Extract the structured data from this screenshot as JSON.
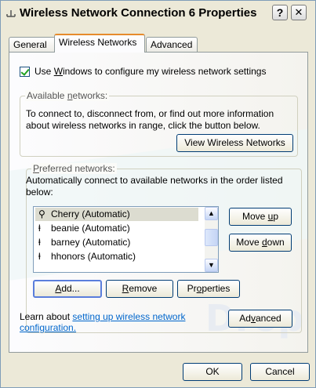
{
  "window": {
    "title": "Wireless Network Connection 6 Properties",
    "help_label": "?",
    "close_label": "✕"
  },
  "tabs": [
    {
      "label": "General"
    },
    {
      "label": "Wireless Networks"
    },
    {
      "label": "Advanced"
    }
  ],
  "use_windows_checkbox": {
    "label_pre": "Use ",
    "label_key": "W",
    "label_post": "indows to configure my wireless network settings",
    "checked": true
  },
  "available": {
    "title_pre": "Available ",
    "title_key": "n",
    "title_post": "etworks:",
    "line1": "To connect to, disconnect from, or find out more information",
    "line2": "about wireless networks in range, click the button below.",
    "view_button": "View Wireless Networks"
  },
  "preferred": {
    "title_key": "P",
    "title_post": "referred networks:",
    "line1": "Automatically connect to available networks in the order listed",
    "line2": "below:",
    "networks": [
      {
        "name": "Cherry (Automatic)",
        "icon": "wireless-network-connected-icon"
      },
      {
        "name": "beanie (Automatic)",
        "icon": "wireless-network-icon"
      },
      {
        "name": "barney (Automatic)",
        "icon": "wireless-network-icon"
      },
      {
        "name": "hhonors (Automatic)",
        "icon": "wireless-network-icon"
      }
    ],
    "move_up_pre": "Move ",
    "move_up_key": "u",
    "move_up_post": "p",
    "move_down_pre": "Move ",
    "move_down_key": "d",
    "move_down_post": "own",
    "add_key": "A",
    "add_post": "dd...",
    "remove_key": "R",
    "remove_post": "emove",
    "properties_pre": "Pr",
    "properties_key": "o",
    "properties_post": "perties"
  },
  "learn": {
    "prefix": "Learn about ",
    "link_line1": "setting up wireless network",
    "link_line2": "configuration."
  },
  "advanced_button": {
    "pre": "Ad",
    "key": "v",
    "post": "anced"
  },
  "ok_button": "OK",
  "cancel_button": "Cancel"
}
